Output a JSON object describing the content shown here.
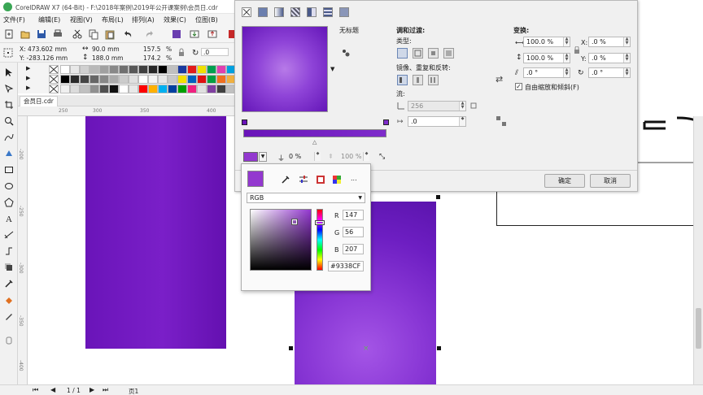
{
  "app": {
    "title": "CorelDRAW X7 (64-Bit) - F:\\2018年案例\\2019年公开课案例\\会员日.cdr",
    "menus": [
      "文件(F)",
      "编辑(E)",
      "视图(V)",
      "布局(L)",
      "排列(A)",
      "效果(C)",
      "位图(B)"
    ],
    "document_tab": "会员日.cdr"
  },
  "property_bar": {
    "x": "X: 473.602 mm",
    "y": "Y: -283.126 mm",
    "width": "90.0 mm",
    "height": "188.0 mm",
    "scale_w": "157.5",
    "scale_h": "174.2",
    "percent": "%",
    "rotation": ".0"
  },
  "rulers": {
    "h_ticks": [
      "250",
      "300",
      "350",
      "400"
    ],
    "v_ticks": [
      "-200",
      "-250",
      "-300",
      "-350",
      "-400"
    ]
  },
  "status": {
    "page_count": "1 / 1",
    "page_name": "页1"
  },
  "palette": {
    "colors": [
      "#ffffff",
      "#e8e8e8",
      "#d0d0d0",
      "#b8b8b8",
      "#a0a0a0",
      "#888888",
      "#707070",
      "#585858",
      "#404040",
      "#282828",
      "#000000",
      "#c0c0c0",
      "#1a3a9e",
      "#e21a1a",
      "#f0e000",
      "#00a050",
      "#e040b0",
      "#00a0e0",
      "#f08020",
      "#a020e0"
    ],
    "colors_row2": [
      "#000000",
      "#2a2a2a",
      "#444",
      "#666",
      "#888",
      "#aaa",
      "#ccc",
      "#e0e0e0",
      "#ffffff",
      "#f5f5f5",
      "#e8e8e8",
      "#c8c8c8",
      "#f4e000",
      "#0060c0",
      "#e01010",
      "#00a040",
      "#f07020",
      "#f0b040",
      "#e8d890",
      "#a06030"
    ],
    "colors_row3": [
      "#f0f0f0",
      "#dcdcdc",
      "#c0c0c0",
      "#909090",
      "#505050",
      "#101010",
      "#ffffff",
      "#e8e8e8",
      "#ff0000",
      "#ffb000",
      "#00b0f0",
      "#0040a0",
      "#00a000",
      "#f02080",
      "#e0e0e0",
      "#8040a0",
      "#404040",
      "#c0c0c0",
      "#202020",
      "#606060"
    ],
    "right_colors": [
      "#f07020",
      "#f0a040",
      "#f0c060",
      "#e8d890",
      "#f0e0b0"
    ]
  },
  "fill_dialog": {
    "preset_label": "无标题",
    "blend_section": "调和过渡:",
    "type_label": "类型:",
    "mirror_label": "镜像、重复和反转:",
    "steps_label": "流:",
    "steps_value": "256",
    "offset_value": ".0",
    "transform_section": "变换:",
    "width_pct": "100.0 %",
    "height_pct": "100.0 %",
    "x_val": ".0 %",
    "y_val": ".0 %",
    "skew_val": ".0 °",
    "rotate_val": ".0 °",
    "free_scale_label": "自由缩放和倾斜(F)",
    "transparency": "0 %",
    "node_pos": "100 %",
    "ok_label": "确定",
    "cancel_label": "取消",
    "x_label": "X:",
    "y_label": "Y:"
  },
  "color_picker": {
    "model": "RGB",
    "r_label": "R",
    "g_label": "G",
    "b_label": "B",
    "r": "147",
    "g": "56",
    "b": "207",
    "hex": "#9338CF",
    "more_label": "..."
  }
}
